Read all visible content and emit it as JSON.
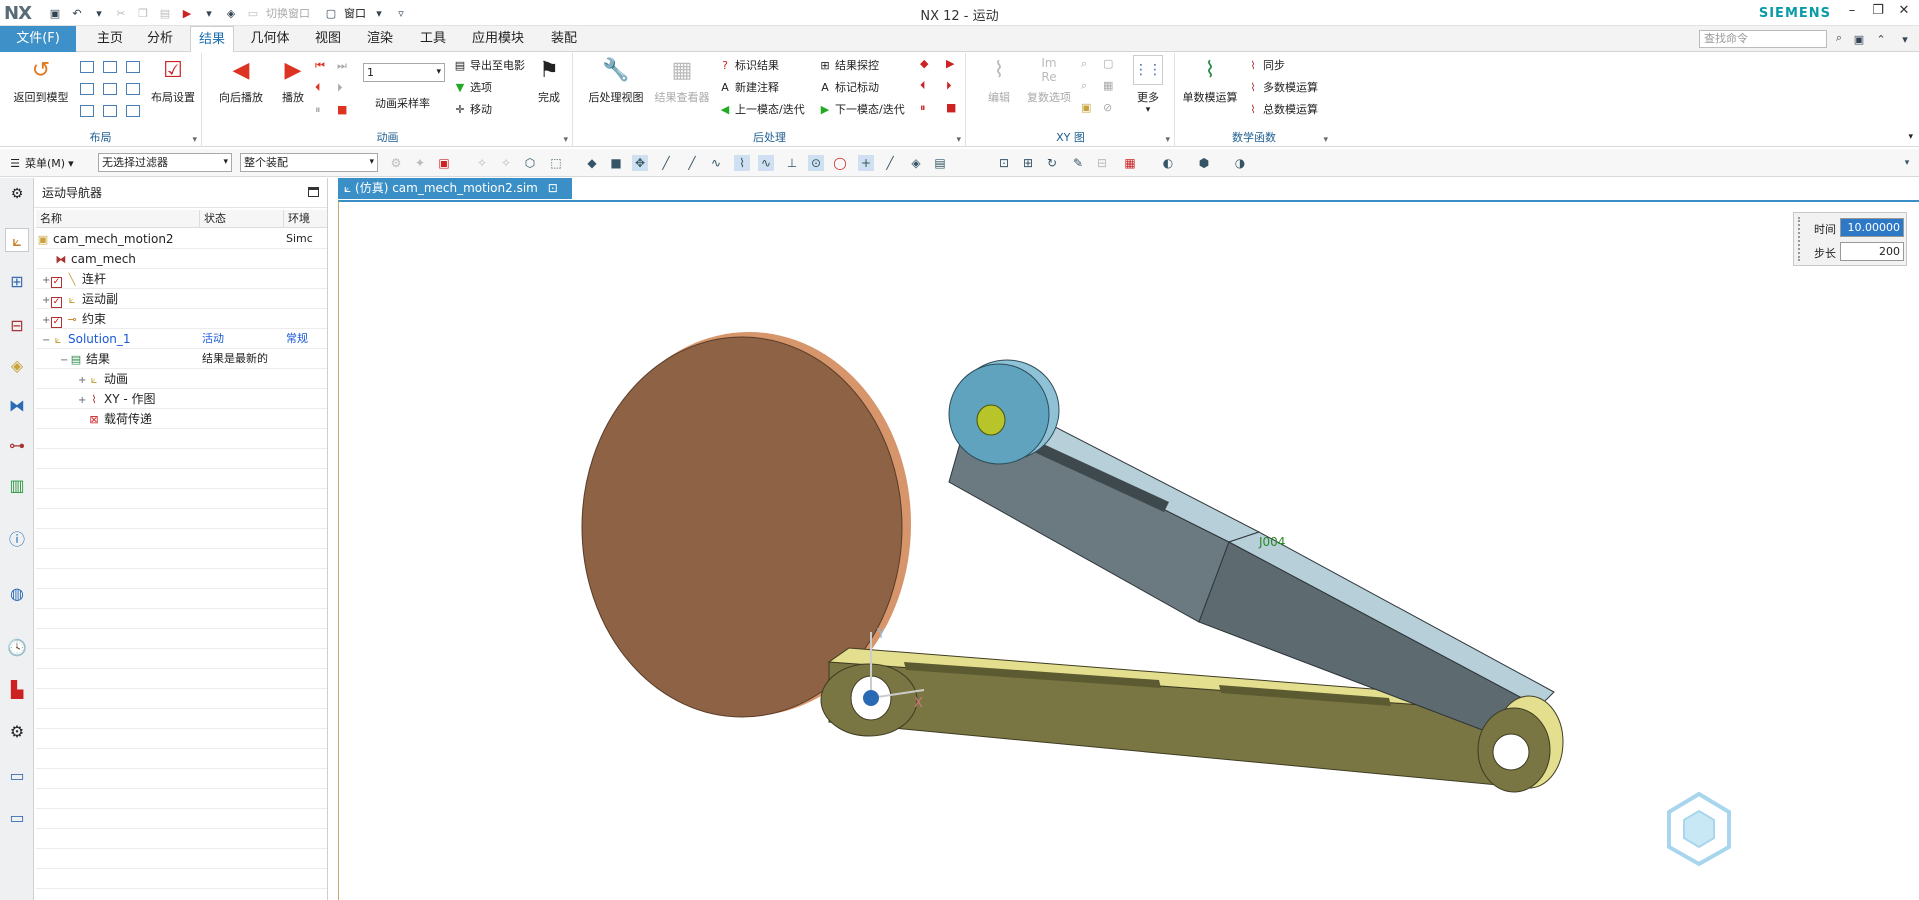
{
  "app": {
    "logo": "NX",
    "title": "NX 12 - 运动",
    "brand": "SIEMENS",
    "accent": "#3d90c8"
  },
  "quick_access": {
    "switch_window": "切换窗口",
    "window": "窗口"
  },
  "menu": {
    "file": "文件(F)",
    "tabs": [
      "主页",
      "分析",
      "结果",
      "几何体",
      "视图",
      "渲染",
      "工具",
      "应用模块",
      "装配"
    ],
    "active_tab": "结果",
    "search_placeholder": "查找命令"
  },
  "ribbon": {
    "layout": {
      "label": "布局",
      "return_model": "返回到模型",
      "layout_settings": "布局设置"
    },
    "animation": {
      "label": "动画",
      "back_forth": "向后播放",
      "play": "播放",
      "step_value": "1",
      "sample_rate": "动画采样率",
      "export_movie": "导出至电影",
      "options": "选项",
      "move": "移动",
      "finish": "完成"
    },
    "postprocess": {
      "label": "后处理",
      "post_view": "后处理视图",
      "result_viewer": "结果查看器",
      "mark_result": "标识结果",
      "new_note": "新建注释",
      "prev_mode": "上一模态/迭代",
      "result_probe": "结果探控",
      "mark_marker": "标记标动",
      "next_mode": "下一模态/迭代"
    },
    "xy": {
      "label": "XY 图",
      "edit": "编辑",
      "complex_options": "复数选项",
      "more": "更多"
    },
    "math": {
      "label": "数学函数",
      "single_op": "单数模运算",
      "sync": "同步",
      "multi_op": "多数模运算",
      "total_op": "总数模运算"
    }
  },
  "toolbar": {
    "menu": "菜单(M)",
    "filter": "无选择过滤器",
    "assembly": "整个装配"
  },
  "navigator": {
    "title": "运动导航器",
    "columns": {
      "name": "名称",
      "status": "状态",
      "env": "环境"
    },
    "rows": [
      {
        "name": "cam_mech_motion2",
        "status": "",
        "env": "Simc"
      },
      {
        "name": "cam_mech",
        "status": "",
        "env": ""
      },
      {
        "name": "连杆",
        "status": "",
        "env": ""
      },
      {
        "name": "运动副",
        "status": "",
        "env": ""
      },
      {
        "name": "约束",
        "status": "",
        "env": ""
      },
      {
        "name": "Solution_1",
        "status": "活动",
        "env": "常规"
      },
      {
        "name": "结果",
        "status": "结果是最新的",
        "env": ""
      },
      {
        "name": "动画",
        "status": "",
        "env": ""
      },
      {
        "name": "XY - 作图",
        "status": "",
        "env": ""
      },
      {
        "name": "载荷传递",
        "status": "",
        "env": ""
      }
    ]
  },
  "graphics": {
    "tab": "(仿真) cam_mech_motion2.sim",
    "time_label": "时间",
    "time_value": "10.00000",
    "step_label": "步长",
    "step_value": "200",
    "axis_x": "X",
    "axis_y": "Y",
    "joint_label": "J004",
    "colors": {
      "cam": "#8d6245",
      "cam_edge": "#d6956a",
      "link_gray": "#6b7a80",
      "link_olive": "#7a7643",
      "roller": "#5fa3bf",
      "pin": "#b7c42a"
    }
  }
}
